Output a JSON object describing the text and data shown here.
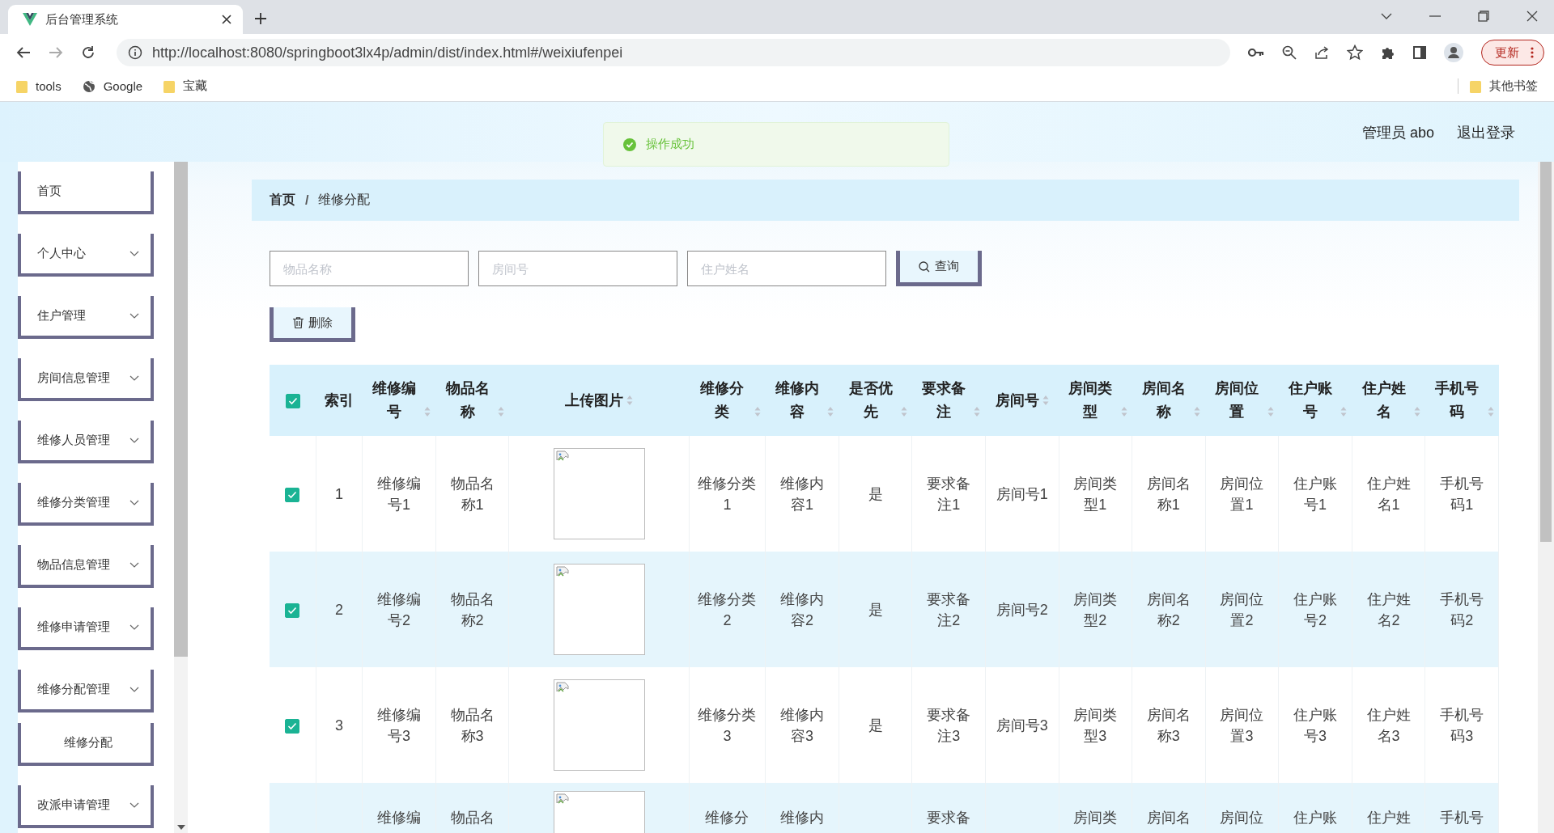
{
  "browser": {
    "tab_title": "后台管理系统",
    "url": "http://localhost:8080/springboot3lx4p/admin/dist/index.html#/weixiufenpei",
    "update_button": "更新",
    "bookmarks": [
      {
        "label": "tools",
        "kind": "folder"
      },
      {
        "label": "Google",
        "kind": "globe"
      },
      {
        "label": "宝藏",
        "kind": "folder"
      }
    ],
    "other_bookmarks": "其他书签"
  },
  "header": {
    "user": "管理员 abo",
    "logout": "退出登录"
  },
  "toast": {
    "message": "操作成功"
  },
  "sidebar": {
    "items": [
      {
        "label": "首页",
        "kind": "link"
      },
      {
        "label": "个人中心",
        "kind": "menu"
      },
      {
        "label": "住户管理",
        "kind": "menu"
      },
      {
        "label": "房间信息管理",
        "kind": "menu"
      },
      {
        "label": "维修人员管理",
        "kind": "menu"
      },
      {
        "label": "维修分类管理",
        "kind": "menu"
      },
      {
        "label": "物品信息管理",
        "kind": "menu"
      },
      {
        "label": "维修申请管理",
        "kind": "menu"
      },
      {
        "label": "维修分配管理",
        "kind": "menu",
        "children": [
          {
            "label": "维修分配"
          }
        ]
      },
      {
        "label": "改派申请管理",
        "kind": "menu"
      }
    ]
  },
  "breadcrumb": {
    "items": [
      "首页",
      "维修分配"
    ],
    "separator": "/"
  },
  "search": {
    "fields": [
      {
        "placeholder": "物品名称"
      },
      {
        "placeholder": "房间号"
      },
      {
        "placeholder": "住户姓名"
      }
    ],
    "button": "查询"
  },
  "delete_button": "删除",
  "table": {
    "all_selected": true,
    "columns": [
      {
        "label": "索引",
        "sortable": false
      },
      {
        "label": "维修编号",
        "sortable": true
      },
      {
        "label": "物品名称",
        "sortable": true
      },
      {
        "label": "上传图片",
        "sortable": true
      },
      {
        "label": "维修分类",
        "sortable": true
      },
      {
        "label": "维修内容",
        "sortable": true
      },
      {
        "label": "是否优先",
        "sortable": true
      },
      {
        "label": "要求备注",
        "sortable": true
      },
      {
        "label": "房间号",
        "sortable": true
      },
      {
        "label": "房间类型",
        "sortable": true
      },
      {
        "label": "房间名称",
        "sortable": true
      },
      {
        "label": "房间位置",
        "sortable": true
      },
      {
        "label": "住户账号",
        "sortable": true
      },
      {
        "label": "住户姓名",
        "sortable": true
      },
      {
        "label": "手机号码",
        "sortable": true
      }
    ],
    "rows": [
      {
        "selected": true,
        "cells": [
          {
            "kind": "text",
            "text": "1"
          },
          {
            "kind": "text",
            "text": "维修编号1"
          },
          {
            "kind": "text",
            "text": "物品名称1"
          },
          {
            "kind": "image"
          },
          {
            "kind": "text",
            "text": "维修分类1"
          },
          {
            "kind": "text",
            "text": "维修内容1"
          },
          {
            "kind": "text",
            "text": "是"
          },
          {
            "kind": "text",
            "text": "要求备注1"
          },
          {
            "kind": "text",
            "text": "房间号1"
          },
          {
            "kind": "text",
            "text": "房间类型1"
          },
          {
            "kind": "text",
            "text": "房间名称1"
          },
          {
            "kind": "text",
            "text": "房间位置1"
          },
          {
            "kind": "text",
            "text": "住户账号1"
          },
          {
            "kind": "text",
            "text": "住户姓名1"
          },
          {
            "kind": "text",
            "text": "手机号码1"
          }
        ]
      },
      {
        "selected": true,
        "cells": [
          {
            "kind": "text",
            "text": "2"
          },
          {
            "kind": "text",
            "text": "维修编号2"
          },
          {
            "kind": "text",
            "text": "物品名称2"
          },
          {
            "kind": "image"
          },
          {
            "kind": "text",
            "text": "维修分类2"
          },
          {
            "kind": "text",
            "text": "维修内容2"
          },
          {
            "kind": "text",
            "text": "是"
          },
          {
            "kind": "text",
            "text": "要求备注2"
          },
          {
            "kind": "text",
            "text": "房间号2"
          },
          {
            "kind": "text",
            "text": "房间类型2"
          },
          {
            "kind": "text",
            "text": "房间名称2"
          },
          {
            "kind": "text",
            "text": "房间位置2"
          },
          {
            "kind": "text",
            "text": "住户账号2"
          },
          {
            "kind": "text",
            "text": "住户姓名2"
          },
          {
            "kind": "text",
            "text": "手机号码2"
          }
        ]
      },
      {
        "selected": true,
        "cells": [
          {
            "kind": "text",
            "text": "3"
          },
          {
            "kind": "text",
            "text": "维修编号3"
          },
          {
            "kind": "text",
            "text": "物品名称3"
          },
          {
            "kind": "image"
          },
          {
            "kind": "text",
            "text": "维修分类3"
          },
          {
            "kind": "text",
            "text": "维修内容3"
          },
          {
            "kind": "text",
            "text": "是"
          },
          {
            "kind": "text",
            "text": "要求备注3"
          },
          {
            "kind": "text",
            "text": "房间号3"
          },
          {
            "kind": "text",
            "text": "房间类型3"
          },
          {
            "kind": "text",
            "text": "房间名称3"
          },
          {
            "kind": "text",
            "text": "房间位置3"
          },
          {
            "kind": "text",
            "text": "住户账号3"
          },
          {
            "kind": "text",
            "text": "住户姓名3"
          },
          {
            "kind": "text",
            "text": "手机号码3"
          }
        ]
      },
      {
        "cells": [
          {
            "kind": "blank"
          },
          {
            "kind": "text",
            "text": "维修编"
          },
          {
            "kind": "text",
            "text": "物品名"
          },
          {
            "kind": "image"
          },
          {
            "kind": "text",
            "text": "维修分"
          },
          {
            "kind": "text",
            "text": "维修内"
          },
          {
            "kind": "blank"
          },
          {
            "kind": "text",
            "text": "要求备"
          },
          {
            "kind": "blank"
          },
          {
            "kind": "text",
            "text": "房间类"
          },
          {
            "kind": "text",
            "text": "房间名"
          },
          {
            "kind": "text",
            "text": "房间位"
          },
          {
            "kind": "text",
            "text": "住户账"
          },
          {
            "kind": "text",
            "text": "住户姓"
          },
          {
            "kind": "text",
            "text": "手机号"
          }
        ]
      }
    ]
  }
}
